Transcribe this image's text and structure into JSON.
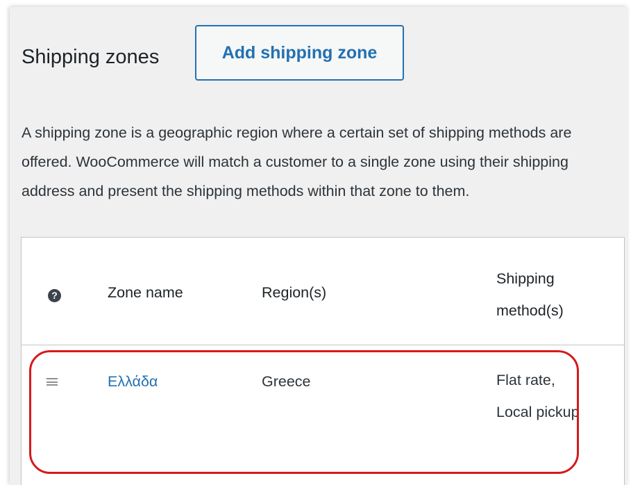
{
  "header": {
    "title": "Shipping zones",
    "add_button_label": "Add shipping zone"
  },
  "description": "A shipping zone is a geographic region where a certain set of shipping methods are offered. WooCommerce will match a customer to a single zone using their shipping address and present the shipping methods within that zone to them.",
  "table": {
    "help_icon_glyph": "?",
    "columns": {
      "zone_name": "Zone name",
      "regions": "Region(s)",
      "methods": "Shipping method(s)"
    },
    "rows": [
      {
        "zone_name": "Ελλάδα",
        "regions": "Greece",
        "methods": "Flat rate, Local pickup"
      }
    ]
  },
  "annotation": {
    "highlight_color": "#d7191c"
  },
  "colors": {
    "link": "#2271b1",
    "panel_bg": "#f0f0f1"
  }
}
